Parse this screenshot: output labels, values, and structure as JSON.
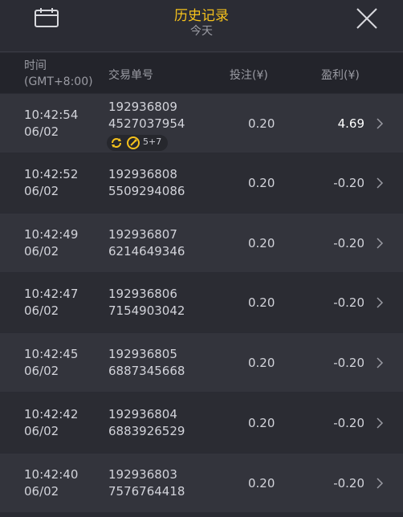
{
  "header": {
    "title": "历史记录",
    "subtitle": "今天",
    "calendar_icon": "calendar-icon",
    "close_icon": "close-icon"
  },
  "columns": {
    "time_line1": "时间",
    "time_line2": "(GMT+8:00)",
    "id": "交易单号",
    "bet": "投注(¥)",
    "profit": "盈利(¥)"
  },
  "rows": [
    {
      "time": "10:42:54",
      "date": "06/02",
      "id1": "192936809",
      "id2": "4527037954",
      "bet": "0.20",
      "profit": "4.69",
      "badge": "5+7"
    },
    {
      "time": "10:42:52",
      "date": "06/02",
      "id1": "192936808",
      "id2": "5509294086",
      "bet": "0.20",
      "profit": "-0.20"
    },
    {
      "time": "10:42:49",
      "date": "06/02",
      "id1": "192936807",
      "id2": "6214649346",
      "bet": "0.20",
      "profit": "-0.20"
    },
    {
      "time": "10:42:47",
      "date": "06/02",
      "id1": "192936806",
      "id2": "7154903042",
      "bet": "0.20",
      "profit": "-0.20"
    },
    {
      "time": "10:42:45",
      "date": "06/02",
      "id1": "192936805",
      "id2": "6887345668",
      "bet": "0.20",
      "profit": "-0.20"
    },
    {
      "time": "10:42:42",
      "date": "06/02",
      "id1": "192936804",
      "id2": "6883926529",
      "bet": "0.20",
      "profit": "-0.20"
    },
    {
      "time": "10:42:40",
      "date": "06/02",
      "id1": "192936803",
      "id2": "7576764418",
      "bet": "0.20",
      "profit": "-0.20"
    }
  ],
  "colors": {
    "accent": "#f6c21c",
    "background": "#2a2b33",
    "row_odd": "#33343c",
    "row_even": "#2b2c33"
  }
}
